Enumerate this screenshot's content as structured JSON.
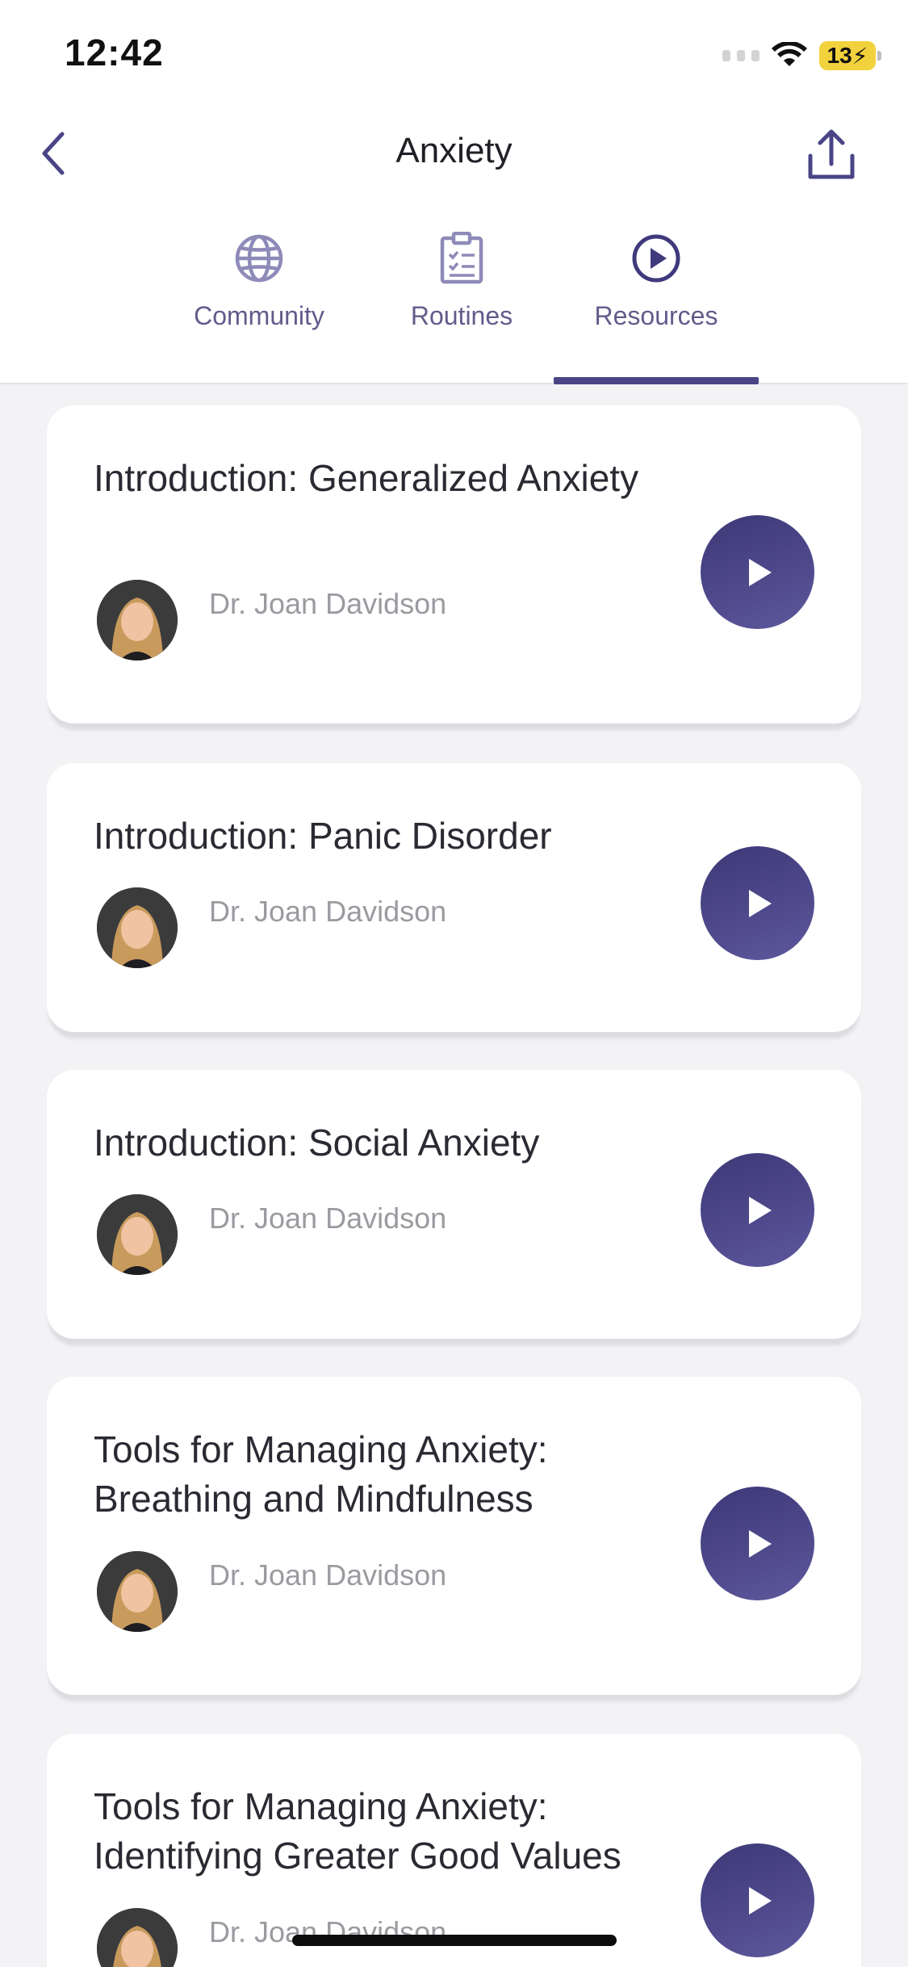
{
  "status_bar": {
    "time": "12:42",
    "battery_level": "13"
  },
  "nav": {
    "title": "Anxiety",
    "back_icon": "chevron-left-icon",
    "share_icon": "share-icon"
  },
  "tabs": [
    {
      "label": "Community",
      "icon": "globe-icon",
      "selected": false
    },
    {
      "label": "Routines",
      "icon": "clipboard-checklist-icon",
      "selected": false
    },
    {
      "label": "Resources",
      "icon": "play-circle-icon",
      "selected": true
    }
  ],
  "colors": {
    "accent": "#4a4586",
    "play_button": "#4a4586",
    "background": "#f3f3f6",
    "card": "#ffffff",
    "author_text": "#9a9aa0"
  },
  "resources": [
    {
      "title": "Introduction: Generalized Anxiety",
      "author": "Dr. Joan Davidson"
    },
    {
      "title": "Introduction: Panic Disorder",
      "author": "Dr. Joan Davidson"
    },
    {
      "title": "Introduction: Social Anxiety",
      "author": "Dr. Joan Davidson"
    },
    {
      "title": "Tools for Managing Anxiety: Breathing and Mindfulness",
      "author": "Dr. Joan Davidson"
    },
    {
      "title": "Tools for Managing Anxiety: Identifying Greater Good Values",
      "author": "Dr. Joan Davidson"
    }
  ]
}
